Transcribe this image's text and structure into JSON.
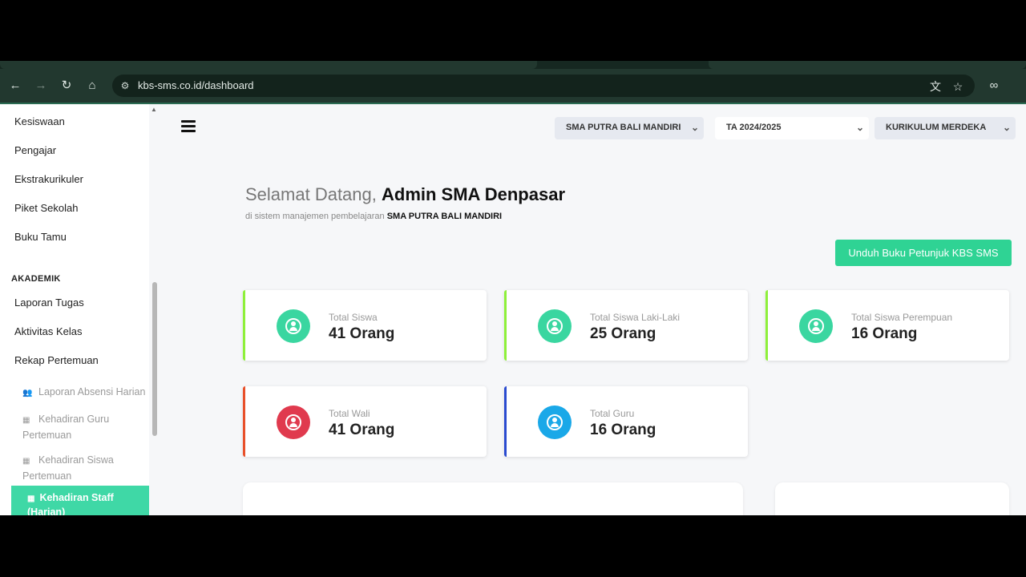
{
  "browser": {
    "url": "kbs-sms.co.id/dashboard"
  },
  "sidebar": {
    "items_top": [
      "Kesiswaan",
      "Pengajar",
      "Ekstrakurikuler",
      "Piket Sekolah",
      "Buku Tamu"
    ],
    "section_heading": "AKADEMIK",
    "items_akademik": [
      "Laporan Tugas",
      "Aktivitas Kelas",
      "Rekap Pertemuan"
    ],
    "sub_items": [
      "Laporan Absensi Harian",
      "Kehadiran Guru Pertemuan",
      "Kehadiran Siswa Pertemuan"
    ],
    "active_item": "Kehadiran Staff (Harian)"
  },
  "filters": {
    "school": "SMA PUTRA BALI MANDIRI",
    "year": "TA 2024/2025",
    "curriculum": "KURIKULUM MERDEKA"
  },
  "welcome": {
    "greeting": "Selamat Datang,",
    "name": "Admin SMA Denpasar",
    "subtitle": "di sistem manajemen pembelajaran",
    "school": "SMA PUTRA BALI MANDIRI"
  },
  "download_button": "Unduh Buku Petunjuk KBS SMS",
  "stats": [
    {
      "label": "Total Siswa",
      "value": "41 Orang",
      "accent": "#8ef03a",
      "icon_color": "#3ad6a0"
    },
    {
      "label": "Total Siswa Laki-Laki",
      "value": "25 Orang",
      "accent": "#8ef03a",
      "icon_color": "#3ad6a0"
    },
    {
      "label": "Total Siswa Perempuan",
      "value": "16 Orang",
      "accent": "#8ef03a",
      "icon_color": "#3ad6a0"
    },
    {
      "label": "Total Wali",
      "value": "41 Orang",
      "accent": "#e8502a",
      "icon_color": "#e03a4e"
    },
    {
      "label": "Total Guru",
      "value": "16 Orang",
      "accent": "#2a4bd0",
      "icon_color": "#1aa8e8"
    }
  ]
}
